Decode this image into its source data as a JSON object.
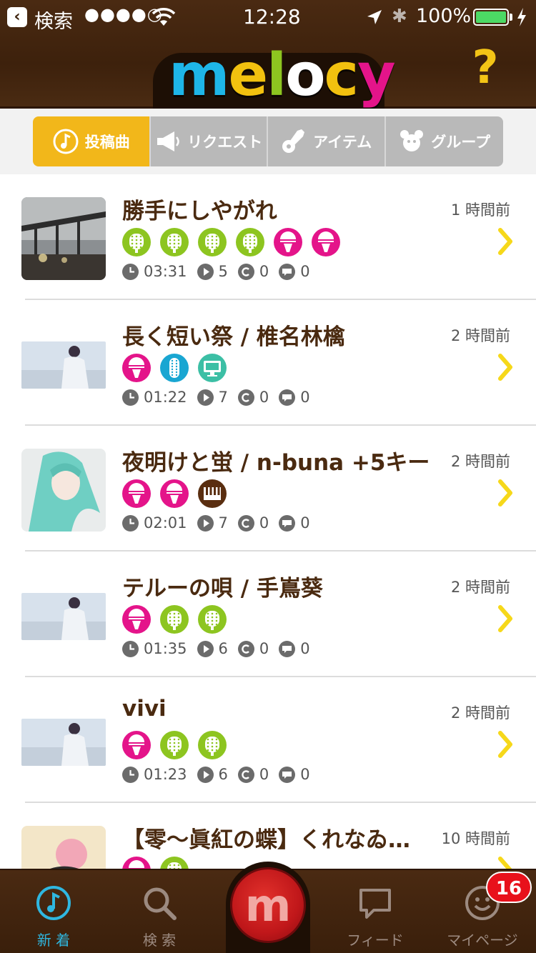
{
  "status_bar": {
    "back_app": "検索",
    "signal": "●●●●○",
    "time": "12:28",
    "battery_text": "100%",
    "bluetooth": "✱"
  },
  "header": {
    "logo_text": [
      "m",
      "e",
      "l",
      "o",
      "c",
      "y"
    ],
    "logo_colors": [
      "#1eb6e8",
      "#f2c10f",
      "#8dc520",
      "#ffffff",
      "#f2c10f",
      "#e4148a"
    ],
    "help_label": "?"
  },
  "tabs": [
    {
      "label": "投稿曲",
      "icon": "music-note-icon",
      "active": true
    },
    {
      "label": "リクエスト",
      "icon": "megaphone-icon",
      "active": false
    },
    {
      "label": "アイテム",
      "icon": "guitar-icon",
      "active": false
    },
    {
      "label": "グループ",
      "icon": "group-icon",
      "active": false
    }
  ],
  "badge_colors": {
    "guitar": "#8dc520",
    "mic": "#e4148a",
    "bass": "#19a6d2",
    "screen": "#3cbfa5",
    "piano": "#5a2e10"
  },
  "posts": [
    {
      "title": "勝手にしやがれ",
      "time_ago": "1 時間前",
      "thumb": "bridge",
      "badges": [
        "guitar",
        "guitar",
        "guitar",
        "guitar",
        "mic",
        "mic"
      ],
      "duration": "03:31",
      "plays": "5",
      "collabs": "0",
      "comments": "0"
    },
    {
      "title": "長く短い祭 / 椎名林檎",
      "time_ago": "2 時間前",
      "thumb": "figure",
      "badges": [
        "mic",
        "bass",
        "screen"
      ],
      "duration": "01:22",
      "plays": "7",
      "collabs": "0",
      "comments": "0"
    },
    {
      "title": "夜明けと蛍 / n-buna +5キー",
      "time_ago": "2 時間前",
      "thumb": "miku",
      "badges": [
        "mic",
        "mic",
        "piano"
      ],
      "duration": "02:01",
      "plays": "7",
      "collabs": "0",
      "comments": "0"
    },
    {
      "title": "テルーの唄 / 手嶌葵",
      "time_ago": "2 時間前",
      "thumb": "figure",
      "badges": [
        "mic",
        "guitar",
        "guitar"
      ],
      "duration": "01:35",
      "plays": "6",
      "collabs": "0",
      "comments": "0"
    },
    {
      "title": "vivi",
      "time_ago": "2 時間前",
      "thumb": "figure",
      "badges": [
        "mic",
        "guitar",
        "guitar"
      ],
      "duration": "01:23",
      "plays": "6",
      "collabs": "0",
      "comments": "0"
    },
    {
      "title": "【零～眞紅の蝶】くれなゐ…",
      "time_ago": "10 時間前",
      "thumb": "pink",
      "badges": [
        "mic",
        "guitar"
      ],
      "duration": "",
      "plays": "",
      "collabs": "",
      "comments": ""
    }
  ],
  "bottom_nav": [
    {
      "label": "新 着",
      "icon": "music-note-icon",
      "active": true
    },
    {
      "label": "検 索",
      "icon": "search-icon",
      "active": false
    },
    {
      "label": "",
      "icon": "melocy-record-icon",
      "active": false
    },
    {
      "label": "フィード",
      "icon": "speech-bubble-icon",
      "active": false
    },
    {
      "label": "マイページ",
      "icon": "smiley-icon",
      "active": false
    }
  ],
  "notification_count": "16",
  "center_button_glyph": "m"
}
